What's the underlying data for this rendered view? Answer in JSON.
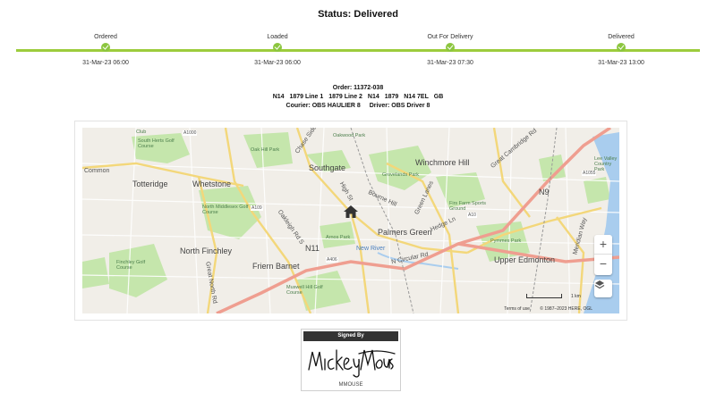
{
  "status": {
    "title": "Status: Delivered"
  },
  "timeline": {
    "steps": [
      {
        "label": "Ordered",
        "time": "31-Mar-23 06:00"
      },
      {
        "label": "Loaded",
        "time": "31-Mar-23 06:00"
      },
      {
        "label": "Out For Delivery",
        "time": "31-Mar-23 07:30"
      },
      {
        "label": "Delivered",
        "time": "31-Mar-23 13:00"
      }
    ],
    "accent": "#8cc63f"
  },
  "order": {
    "number_line": "Order: 11372-038",
    "address": [
      "N14",
      "1879 Line 1",
      "1879 Line 2",
      "N14",
      "1879",
      "N14 7EL",
      "GB"
    ],
    "courier": "Courier: OBS HAULIER 8",
    "driver": "Driver: OBS Driver 8"
  },
  "map": {
    "labels": {
      "southgate": "Southgate",
      "winchmore_hill": "Winchmore Hill",
      "totteridge": "Totteridge",
      "whetstone": "Whetstone",
      "palmers_green": "Palmers Green",
      "north_finchley": "North Finchley",
      "friern_barnet": "Friern Barnet",
      "upper_edmonton": "Upper Edmonton",
      "n11": "N11",
      "n9": "N9",
      "oak_hill_park": "Oak Hill Park",
      "grovelands_park": "Grovelands Park",
      "firs_farm": "Firs Farm Sports Ground",
      "pymmes_park": "Pymmes Park",
      "arnos_park": "Arnos Park",
      "south_herts": "South Herts Golf Course",
      "north_middlesex": "North Middlesex Golf Course",
      "finchley_golf": "Finchley Golf Course",
      "muswell_hill_golf": "Muswell Hill Golf Course",
      "lee_valley": "Lee Valley Country Park",
      "common": "Common",
      "chase_side": "Chase Side",
      "green_lanes": "Green Lanes",
      "high_st": "High St",
      "bourne_hill": "Bourne Hill",
      "hedge_ln": "Hedge Ln",
      "n_circular": "N Circular Rd",
      "oakleigh": "Oakleigh Rd S",
      "great_north": "Great North Rd",
      "great_cambridge": "Great Cambridge Rd",
      "meridian_way": "Meridian Way",
      "new_river": "New River",
      "dalewood_park": "Oakwood Park",
      "a406": "A406",
      "a10": "A10",
      "a109": "A109",
      "a1055": "A1055",
      "a1000": "A1000",
      "club": "Club"
    },
    "zoom_in": "+",
    "zoom_out": "−",
    "scale_label": "1 km",
    "terms": "Terms of use",
    "copyright": "© 1987–2023 HERE, OGL",
    "icons": {
      "marker": "home-icon",
      "layers": "layers-icon"
    },
    "colors": {
      "motorway": "#f0a59a",
      "primary": "#f6d97a",
      "park": "#bfe3a3",
      "water": "#a9cdee"
    }
  },
  "signature": {
    "header": "Signed By",
    "signature_text": "Mickey Mouse",
    "name": "MMOUSE"
  }
}
